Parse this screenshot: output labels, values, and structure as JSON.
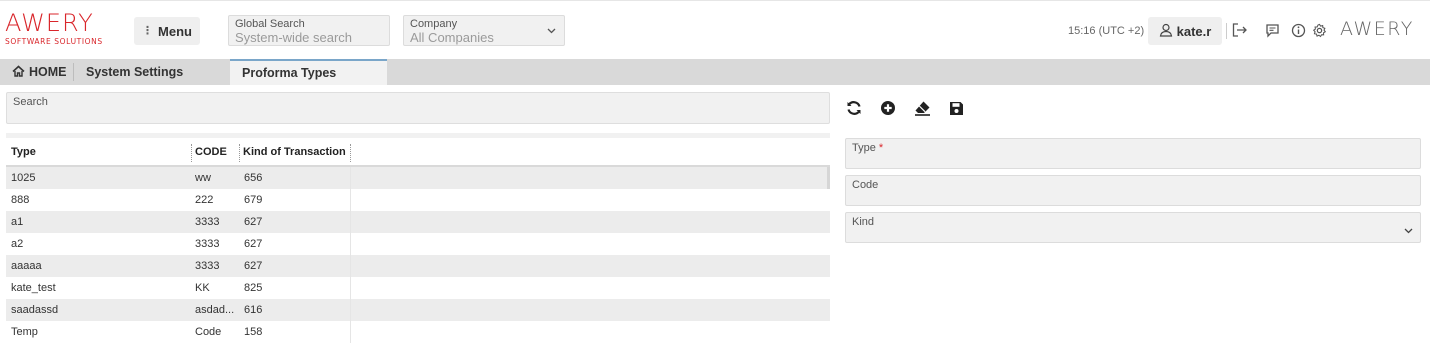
{
  "header": {
    "logo_text": "AWERY",
    "logo_sub": "SOFTWARE SOLUTIONS",
    "menu_label": "Menu",
    "global_search": {
      "label": "Global Search",
      "placeholder": "System-wide search"
    },
    "company": {
      "label": "Company",
      "value": "All Companies"
    },
    "time": "15:16 (UTC +2)",
    "user": "kate.r",
    "brand_right": "AWERY"
  },
  "tabs": [
    {
      "label": "HOME"
    },
    {
      "label": "System Settings"
    },
    {
      "label": "Proforma Types"
    }
  ],
  "search": {
    "label": "Search"
  },
  "table": {
    "columns": [
      "Type",
      "CODE",
      "Kind of Transaction"
    ],
    "rows": [
      {
        "type": "1025",
        "code": "ww",
        "kind": "656"
      },
      {
        "type": "888",
        "code": "222",
        "kind": "679"
      },
      {
        "type": "a1",
        "code": "3333",
        "kind": "627"
      },
      {
        "type": "a2",
        "code": "3333",
        "kind": "627"
      },
      {
        "type": "aaaaa",
        "code": "3333",
        "kind": "627"
      },
      {
        "type": "kate_test",
        "code": "KK",
        "kind": "825"
      },
      {
        "type": "saadassd",
        "code": "asdad...",
        "kind": "616"
      },
      {
        "type": "Temp",
        "code": "Code",
        "kind": "158"
      }
    ]
  },
  "form": {
    "type_label": "Type",
    "type_required_mark": "*",
    "code_label": "Code",
    "kind_label": "Kind"
  },
  "colors": {
    "brand": "#d9262b",
    "tab_active_border": "#7aa6c9"
  }
}
